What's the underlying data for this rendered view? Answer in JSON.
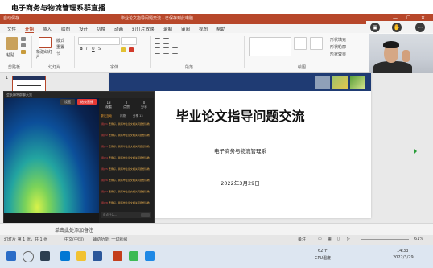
{
  "stream": {
    "title": "电子商务与物流管理系群直播"
  },
  "ppt": {
    "window_title": "毕业论文指导问题交流 - 已保存到此电脑",
    "quick_access": "自动保存",
    "menu": [
      "文件",
      "开始",
      "插入",
      "绘图",
      "设计",
      "切换",
      "动画",
      "幻灯片放映",
      "录制",
      "审阅",
      "视图",
      "帮助"
    ],
    "active_menu": "开始",
    "ribbon_groups": [
      "剪贴板",
      "幻灯片",
      "字体",
      "段落",
      "绘图"
    ],
    "ribbon_buttons": {
      "paste": "粘贴",
      "new_slide": "新建幻灯片",
      "layout": "版式",
      "reset": "重置",
      "section": "节",
      "shape_fill": "形状填充",
      "shape_outline": "形状轮廓",
      "shape_effect": "形状效果"
    }
  },
  "slide": {
    "number": "1",
    "title": "毕业论文指导问题交流",
    "department": "电子商务与物流管理系",
    "date": "2022年3月29日"
  },
  "notes": {
    "placeholder": "单击此处添加备注"
  },
  "status": {
    "slide_info": "幻灯片 第 1 张，共 1 张",
    "language": "中文(中国)",
    "accessibility": "辅助功能: 一切就绪",
    "notes_btn": "备注",
    "zoom": "61%"
  },
  "overlay": {
    "window_label": "会长麻将群聊天览",
    "btn_settings": "设置",
    "btn_live": "结束直播",
    "stats": [
      {
        "v": "13",
        "l": "观看"
      },
      {
        "v": "0",
        "l": "点赞"
      },
      {
        "v": "0",
        "l": "分享"
      }
    ],
    "tabs": [
      "聊天互动",
      "礼物",
      "分享 13"
    ],
    "active_tab": "聊天互动",
    "messages": [
      {
        "user": "用户1",
        "text": "老师好，我有毕业论文相关问题想请教"
      },
      {
        "user": "用户2",
        "text": "老师好，我有毕业论文相关问题想请教"
      },
      {
        "user": "用户3",
        "text": "老师好，我有毕业论文相关问题想请教"
      },
      {
        "user": "用户4",
        "text": "老师好，我有毕业论文相关问题想请教"
      },
      {
        "user": "用户5",
        "text": "老师好，我有毕业论文相关问题想请教"
      },
      {
        "user": "用户6",
        "text": "老师好，我有毕业论文相关问题想请教"
      },
      {
        "user": "用户7",
        "text": "老师好，我有毕业论文相关问题想请教"
      },
      {
        "user": "用户8",
        "text": "老师好，我有毕业论文相关问题想请教"
      }
    ],
    "input_placeholder": "说点什么..."
  },
  "taskbar": {
    "weather": "62°F",
    "weather_desc": "CPU温度",
    "time": "14:33",
    "date": "2022/3/29"
  },
  "colors": {
    "ppt_accent": "#b7472a",
    "slide_band": "#1f3b73",
    "live_red": "#e53935"
  }
}
